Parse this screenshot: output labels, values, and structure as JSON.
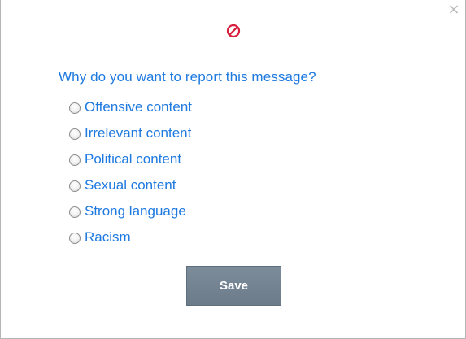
{
  "dialog": {
    "close_symbol": "×",
    "close_icon": "close-icon",
    "header_icon": "ban-icon",
    "header_icon_color": "#d81e3c",
    "question": "Why do you want to report this message?",
    "options": [
      {
        "label": "Offensive content",
        "selected": false
      },
      {
        "label": "Irrelevant content",
        "selected": false
      },
      {
        "label": "Political content",
        "selected": false
      },
      {
        "label": "Sexual content",
        "selected": false
      },
      {
        "label": "Strong language",
        "selected": false
      },
      {
        "label": "Racism",
        "selected": false
      }
    ],
    "save_label": "Save"
  },
  "colors": {
    "link_blue": "#1f7ae0",
    "button_gray": "#76859a",
    "button_text": "#ffffff"
  }
}
